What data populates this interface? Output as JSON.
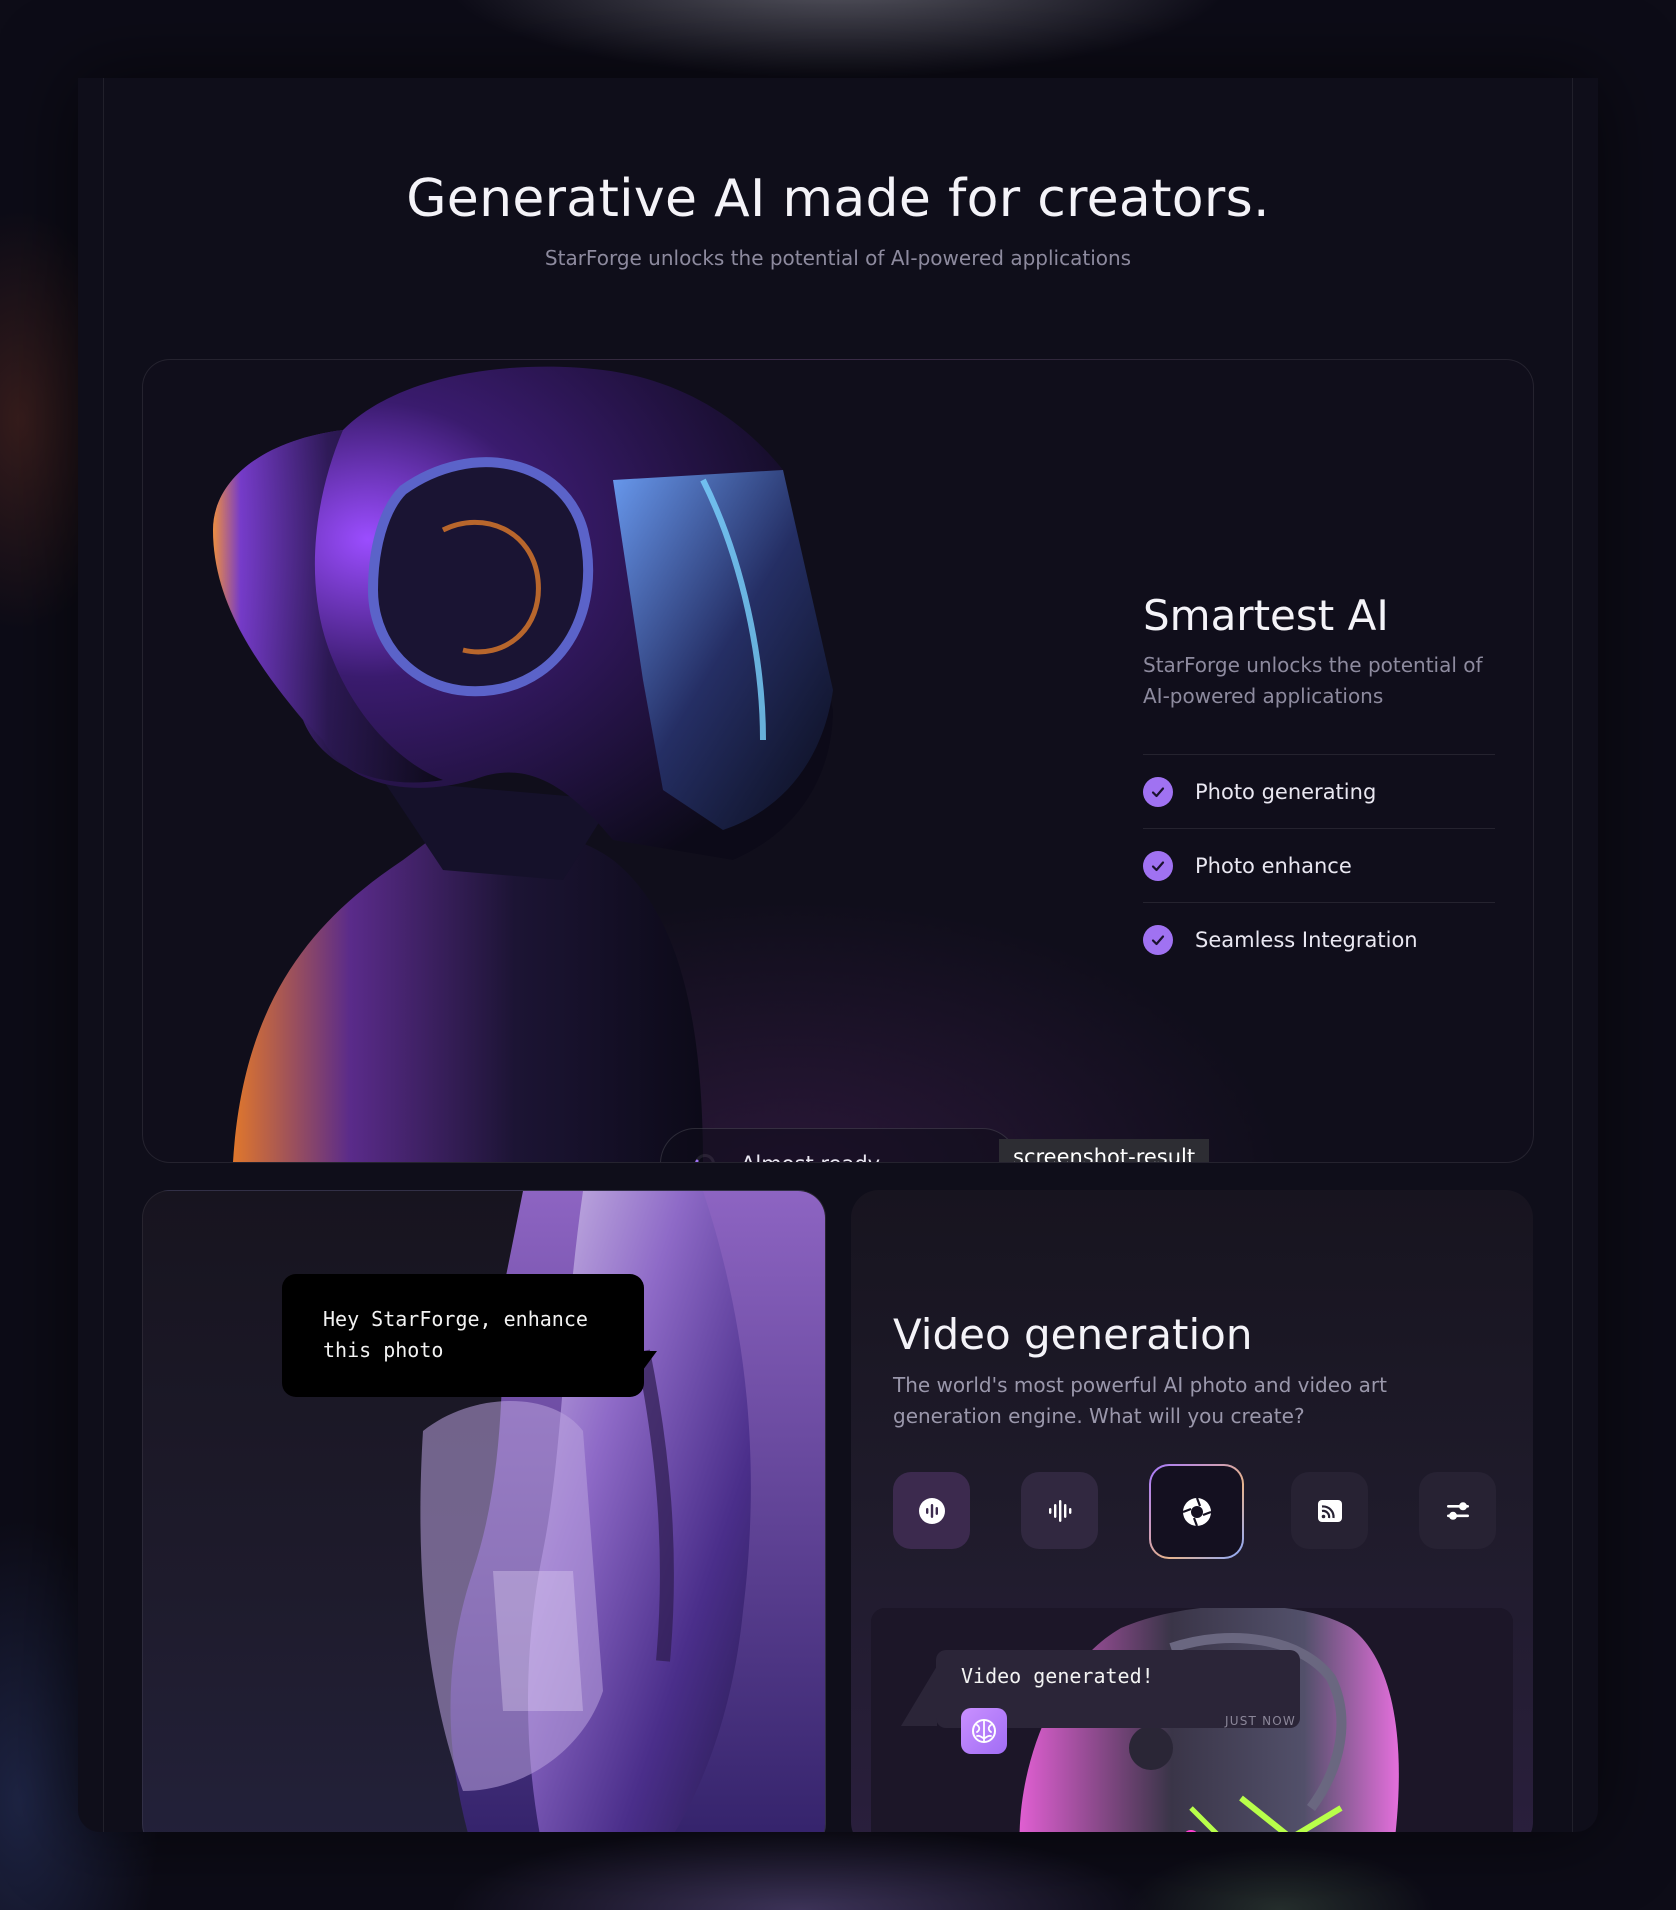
{
  "hero": {
    "title": "Generative AI made for creators.",
    "subtitle": "StarForge unlocks the potential of AI-powered applications"
  },
  "smartest": {
    "title": "Smartest AI",
    "text": "StarForge unlocks the potential of AI-powered applications",
    "features": [
      "Photo generating",
      "Photo enhance",
      "Seamless Integration"
    ],
    "status": "Almost ready...",
    "tooltip": "screenshot-result"
  },
  "enhance": {
    "prompt": "Hey StarForge, enhance this photo"
  },
  "video": {
    "title": "Video generation",
    "text": "The world's most powerful AI photo and video art generation engine. What will you create?",
    "tools": [
      {
        "icon": "audio-wave-circle-icon",
        "active": false
      },
      {
        "icon": "equalizer-icon",
        "active": false
      },
      {
        "icon": "camera-lens-icon",
        "active": true
      },
      {
        "icon": "cast-icon",
        "active": false
      },
      {
        "icon": "sliders-icon",
        "active": false
      }
    ],
    "notification": {
      "text": "Video generated!",
      "time": "JUST NOW",
      "avatar_icon": "brain-icon"
    }
  },
  "colors": {
    "accent": "#a072f2",
    "background": "#0f0e1a",
    "muted_text": "#8d8a9e"
  }
}
